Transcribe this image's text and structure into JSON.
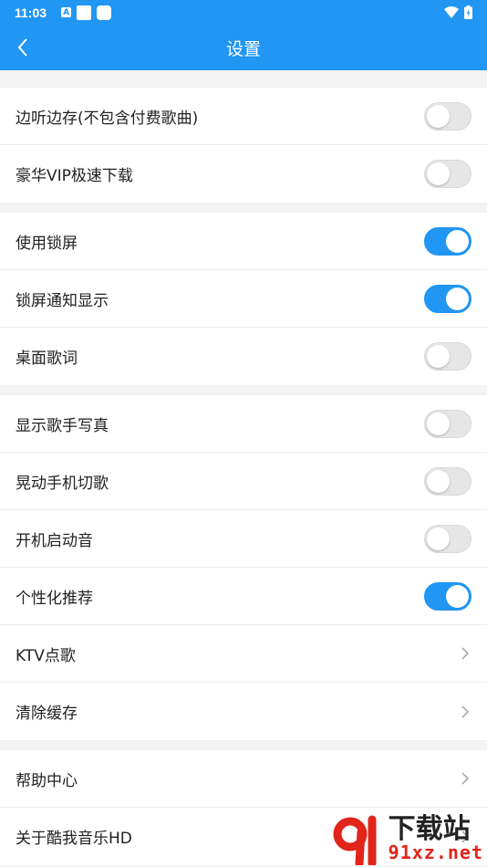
{
  "status": {
    "time": "11:03",
    "icon_a": "A"
  },
  "header": {
    "title": "设置"
  },
  "groups": [
    [
      {
        "label": "边听边存(不包含付费歌曲)",
        "type": "switch",
        "on": false
      },
      {
        "label": "豪华VIP极速下载",
        "type": "switch",
        "on": false
      }
    ],
    [
      {
        "label": "使用锁屏",
        "type": "switch",
        "on": true
      },
      {
        "label": "锁屏通知显示",
        "type": "switch",
        "on": true
      },
      {
        "label": "桌面歌词",
        "type": "switch",
        "on": false
      }
    ],
    [
      {
        "label": "显示歌手写真",
        "type": "switch",
        "on": false
      },
      {
        "label": "晃动手机切歌",
        "type": "switch",
        "on": false
      },
      {
        "label": "开机启动音",
        "type": "switch",
        "on": false
      },
      {
        "label": "个性化推荐",
        "type": "switch",
        "on": true
      },
      {
        "label": "KTV点歌",
        "type": "chevron"
      },
      {
        "label": "清除缓存",
        "type": "chevron"
      }
    ],
    [
      {
        "label": "帮助中心",
        "type": "chevron"
      },
      {
        "label": "关于酷我音乐HD",
        "type": "chevron"
      }
    ]
  ],
  "watermark": {
    "big": "下载站",
    "small": "91xz.net"
  },
  "colors": {
    "accent": "#2196f3",
    "switch_off": "#e6e6e6",
    "watermark_red": "#e1251b"
  }
}
